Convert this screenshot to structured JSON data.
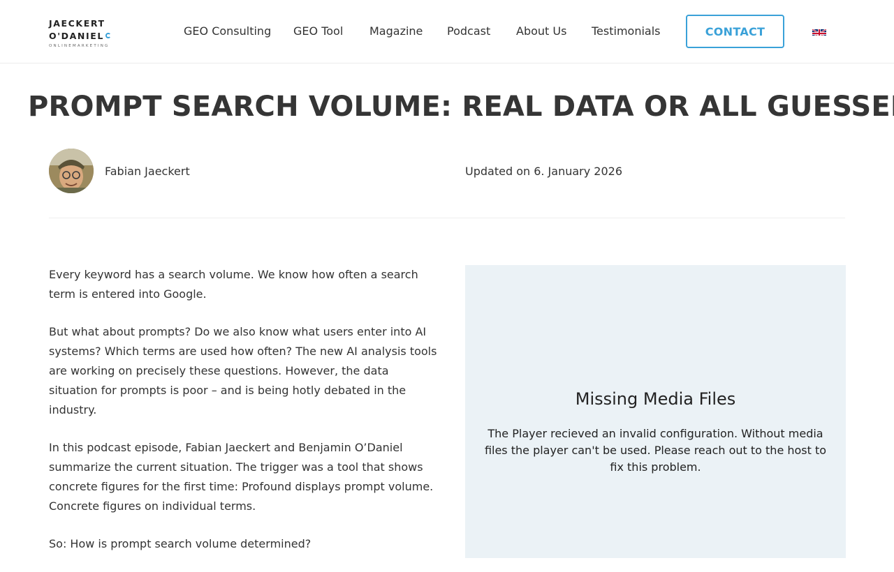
{
  "header": {
    "logo": {
      "line1": "JAECKERT",
      "line2": "O'DANIEL",
      "tagline": "ONLINEMARKETING"
    },
    "nav": [
      {
        "label": "GEO Consulting"
      },
      {
        "label": "GEO Tool"
      },
      {
        "label": "Magazine"
      },
      {
        "label": "Podcast"
      },
      {
        "label": "About Us"
      },
      {
        "label": "Testimonials"
      }
    ],
    "contact_label": "CONTACT",
    "language_icon": "uk-flag-icon"
  },
  "article": {
    "title": "PROMPT SEARCH VOLUME: REAL DATA OR ALL GUESSED?",
    "author": "Fabian Jaeckert",
    "updated": "Updated on 6. January 2026",
    "paragraphs": [
      "Every keyword has a search volume. We know how often a search term is entered into Google.",
      "But what about prompts? Do we also know what users enter into AI systems? Which terms are used how often? The new AI analysis tools are working on precisely these questions. However, the data situation for prompts is poor – and is being hotly debated in the industry.",
      "In this podcast episode, Fabian Jaeckert and Benjamin O’Daniel summarize the current situation. The trigger was a tool that shows concrete figures for the first time: Profound displays prompt volume. Concrete figures on individual terms.",
      "So: How is prompt search volume determined?"
    ]
  },
  "player": {
    "title": "Missing Media Files",
    "message": "The Player recieved an invalid configuration. Without media files the player can't be used. Please reach out to the host to fix this problem."
  },
  "colors": {
    "accent": "#3aa1d8",
    "player_bg": "#ebf2f6",
    "text": "#333333"
  }
}
